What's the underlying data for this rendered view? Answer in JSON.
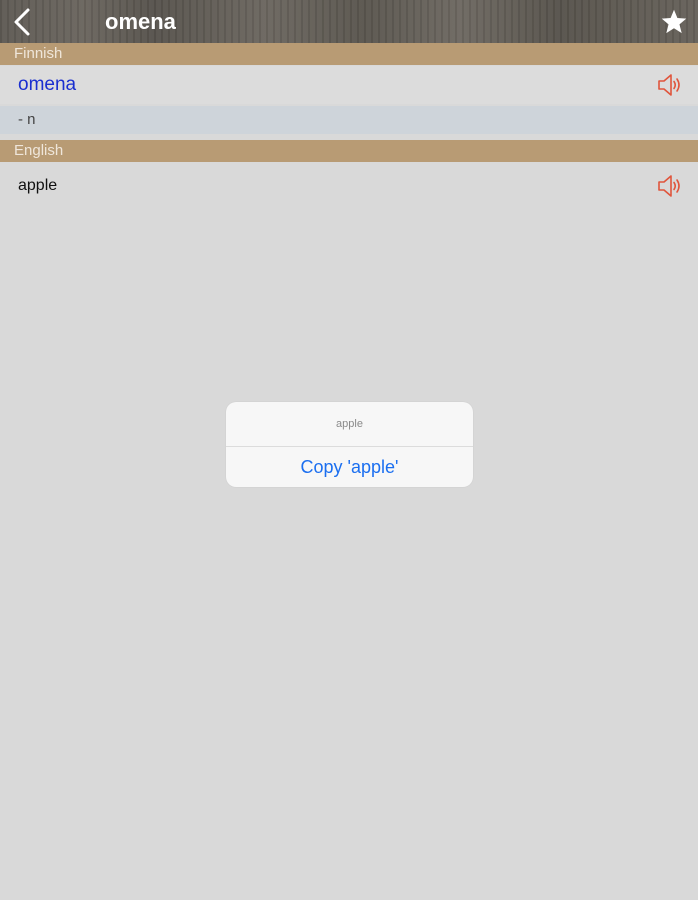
{
  "navbar": {
    "title": "omena",
    "back_icon": "chevron-left-icon",
    "favorite_icon": "star-icon"
  },
  "sections": {
    "finnish": {
      "header": "Finnish",
      "word": "omena",
      "grammar": "- n",
      "speaker_icon": "speaker-icon"
    },
    "english": {
      "header": "English",
      "word": "apple",
      "speaker_icon": "speaker-icon"
    }
  },
  "alert": {
    "title": "apple",
    "action_label": "Copy 'apple'"
  },
  "colors": {
    "section_header_bg": "#b89b74",
    "finnish_word": "#1a2fd0",
    "speaker": "#e0553c",
    "alert_action": "#1b6ff0"
  }
}
